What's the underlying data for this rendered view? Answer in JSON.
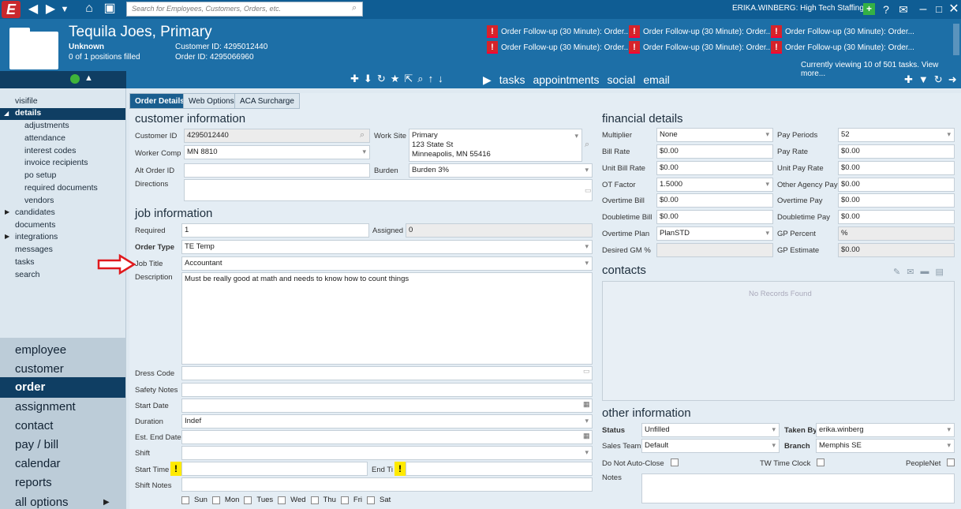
{
  "topbar": {
    "logo": "E",
    "search_placeholder": "Search for Employees, Customers, Orders, etc.",
    "user": "ERIKA.WINBERG: High Tech Staffing"
  },
  "header": {
    "title": "Tequila Joes, Primary",
    "status": "Unknown",
    "positions": "0 of 1 positions filled",
    "customer_id": "Customer ID: 4295012440",
    "order_id": "Order ID: 4295066960"
  },
  "alerts": [
    "Order Follow-up (30 Minute): Order...",
    "Order Follow-up (30 Minute): Order...",
    "Order Follow-up (30 Minute): Order...",
    "Order Follow-up (30 Minute): Order...",
    "Order Follow-up (30 Minute): Order...",
    "Order Follow-up (30 Minute): Order..."
  ],
  "tasks_viewing": "Currently viewing 10 of 501 tasks. View more...",
  "tasknav": [
    "tasks",
    "appointments",
    "social",
    "email"
  ],
  "sidebar": {
    "items": [
      "visifile",
      "details",
      "adjustments",
      "attendance",
      "interest codes",
      "invoice recipients",
      "po setup",
      "required documents",
      "vendors",
      "candidates",
      "documents",
      "integrations",
      "messages",
      "tasks",
      "search"
    ]
  },
  "mainnav": [
    "employee",
    "customer",
    "order",
    "assignment",
    "contact",
    "pay / bill",
    "calendar",
    "reports",
    "all options"
  ],
  "tabs": [
    "Order Details",
    "Web Options",
    "ACA Surcharge"
  ],
  "customer_info": {
    "heading": "customer information",
    "customer_id_label": "Customer ID",
    "customer_id": "4295012440",
    "worker_comp_label": "Worker Comp",
    "worker_comp": "MN 8810",
    "alt_order_label": "Alt Order ID",
    "directions_label": "Directions",
    "work_site_label": "Work Site",
    "work_site_1": "Primary",
    "work_site_2": "123 State St",
    "work_site_3": "Minneapolis, MN 55416",
    "burden_label": "Burden",
    "burden": "Burden 3%"
  },
  "job_info": {
    "heading": "job information",
    "required_label": "Required",
    "required": "1",
    "assigned_label": "Assigned",
    "assigned": "0",
    "order_type_label": "Order Type",
    "order_type": "TE  Temp",
    "job_title_label": "Job Title",
    "job_title": "Accountant",
    "description_label": "Description",
    "description": "Must be really good at math and needs to know how to count things",
    "dress_code_label": "Dress Code",
    "safety_label": "Safety Notes",
    "start_date_label": "Start Date",
    "duration_label": "Duration",
    "duration": "Indef",
    "est_end_label": "Est. End Date",
    "shift_label": "Shift",
    "start_time_label": "Start Time",
    "end_time_label": "End Ti",
    "shift_notes_label": "Shift Notes",
    "days": [
      "Sun",
      "Mon",
      "Tues",
      "Wed",
      "Thu",
      "Fri",
      "Sat"
    ]
  },
  "financial": {
    "heading": "financial details",
    "rows": [
      [
        "Multiplier",
        "None",
        "Pay Periods",
        "52"
      ],
      [
        "Bill Rate",
        "$0.00",
        "Pay Rate",
        "$0.00"
      ],
      [
        "Unit Bill Rate",
        "$0.00",
        "Unit Pay Rate",
        "$0.00"
      ],
      [
        "OT Factor",
        "1.5000",
        "Other Agency Pay",
        "$0.00"
      ],
      [
        "Overtime Bill",
        "$0.00",
        "Overtime Pay",
        "$0.00"
      ],
      [
        "Doubletime Bill",
        "$0.00",
        "Doubletime Pay",
        "$0.00"
      ],
      [
        "Overtime Plan",
        "PlanSTD",
        "GP Percent",
        "%"
      ],
      [
        "Desired GM %",
        "",
        "GP Estimate",
        "$0.00"
      ]
    ]
  },
  "contacts": {
    "heading": "contacts",
    "empty": "No Records Found"
  },
  "other": {
    "heading": "other information",
    "status_label": "Status",
    "status": "Unfilled",
    "taken_by_label": "Taken By",
    "taken_by": "erika.winberg",
    "sales_team_label": "Sales Team",
    "sales_team": "Default",
    "branch_label": "Branch",
    "branch": "Memphis SE",
    "auto_close_label": "Do Not Auto-Close",
    "tw_label": "TW Time Clock",
    "peoplenet_label": "PeopleNet",
    "notes_label": "Notes"
  }
}
